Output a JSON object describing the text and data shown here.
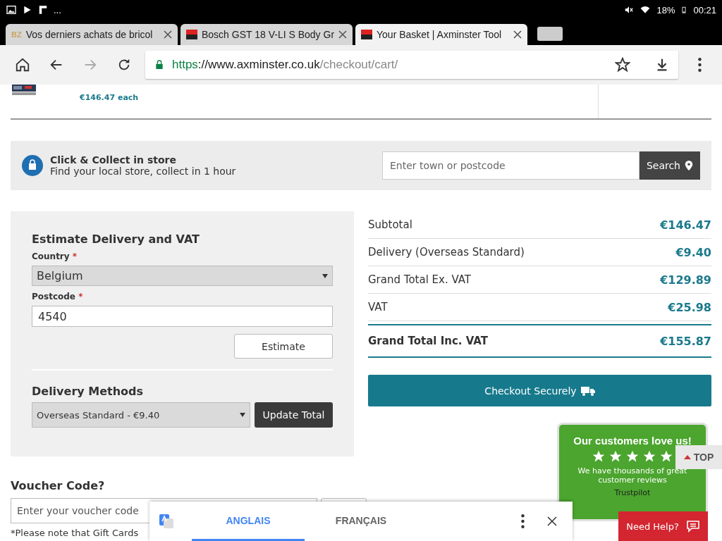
{
  "status_bar": {
    "more": "...",
    "battery": "18%",
    "time": "00:21"
  },
  "browser_tabs": [
    {
      "title": "Vos derniers achats de bricol",
      "favicon": "BZ",
      "selected": false
    },
    {
      "title": "Bosch GST 18 V-LI S Body Gr",
      "selected": false
    },
    {
      "title": "Your Basket | Axminster Tool",
      "selected": true
    }
  ],
  "address_bar": {
    "scheme": "https",
    "host": "://www.axminster.co.uk",
    "path": "/checkout/cart/"
  },
  "product": {
    "price": "€146.47 each"
  },
  "click_collect": {
    "title": "Click & Collect in store",
    "subtitle": "Find your local store, collect in 1 hour",
    "placeholder": "Enter town or postcode",
    "button": "Search"
  },
  "estimate": {
    "title": "Estimate Delivery and VAT",
    "country_label": "Country",
    "required": "*",
    "country": "Belgium",
    "postcode_label": "Postcode",
    "postcode": "4540",
    "estimate_button": "Estimate",
    "methods_title": "Delivery Methods",
    "method": "Overseas Standard - €9.40",
    "update_button": "Update Total"
  },
  "totals": [
    {
      "label": "Subtotal",
      "value": "€146.47",
      "kind": "line"
    },
    {
      "label": "Delivery (Overseas Standard)",
      "value": "€9.40",
      "kind": "line"
    },
    {
      "label": "Grand Total Ex. VAT",
      "value": "€129.89",
      "kind": "line"
    },
    {
      "label": "VAT",
      "value": "€25.98",
      "kind": "line"
    },
    {
      "label": "Grand Total Inc. VAT",
      "value": "€155.87",
      "kind": "grand"
    }
  ],
  "checkout_button": "Checkout Securely",
  "trustpilot": {
    "title": "Our customers love us!",
    "stars": 5,
    "text": "We have thousands of great customer reviews",
    "brand": "Trustpilot"
  },
  "top_button": "TOP",
  "help_button": "Need Help?",
  "voucher": {
    "title": "Voucher Code?",
    "placeholder": "Enter your voucher code",
    "note": "*Please note that Gift Cards"
  },
  "translate": {
    "tabs": [
      {
        "label": "ANGLAIS",
        "selected": true
      },
      {
        "label": "FRANÇAIS",
        "selected": false
      }
    ]
  }
}
